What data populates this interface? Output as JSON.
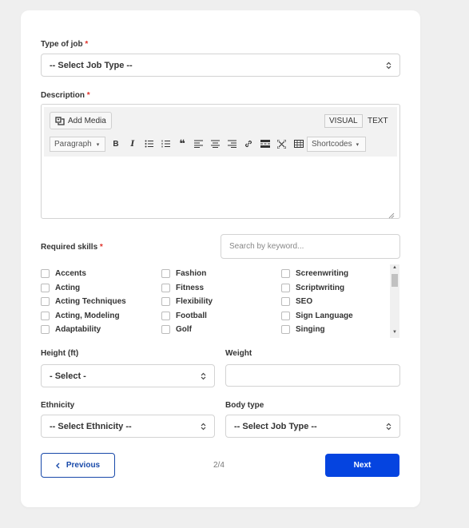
{
  "form": {
    "job_type": {
      "label": "Type of job",
      "required_mark": "*",
      "value": "-- Select Job Type --"
    },
    "description": {
      "label": "Description",
      "required_mark": "*",
      "add_media": "Add Media",
      "tab_visual": "VISUAL",
      "tab_text": "TEXT",
      "format_select": "Paragraph",
      "shortcodes": "Shortcodes"
    },
    "skills": {
      "label": "Required skills",
      "required_mark": "*",
      "search_placeholder": "Search by keyword...",
      "columns": [
        [
          "Accents",
          "Acting",
          "Acting Techniques",
          "Acting, Modeling",
          "Adaptability"
        ],
        [
          "Fashion",
          "Fitness",
          "Flexibility",
          "Football",
          "Golf"
        ],
        [
          "Screenwriting",
          "Scriptwriting",
          "SEO",
          "Sign Language",
          "Singing"
        ]
      ]
    },
    "height": {
      "label": "Height (ft)",
      "value": "- Select -"
    },
    "weight": {
      "label": "Weight",
      "value": ""
    },
    "ethnicity": {
      "label": "Ethnicity",
      "value": "-- Select Ethnicity --"
    },
    "body_type": {
      "label": "Body type",
      "value": "-- Select Job Type --"
    }
  },
  "footer": {
    "previous": "Previous",
    "next": "Next",
    "page_indicator": "2/4"
  },
  "colors": {
    "accent": "#0544e0",
    "required": "#e0322b"
  }
}
